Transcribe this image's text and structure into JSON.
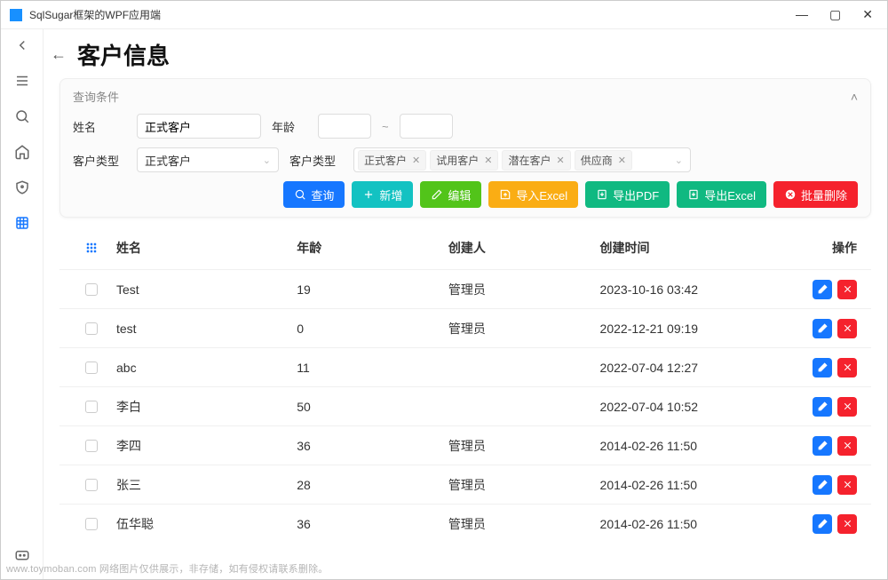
{
  "window": {
    "title": "SqlSugar框架的WPF应用端"
  },
  "page": {
    "title": "客户信息"
  },
  "filter": {
    "panel_label": "查询条件",
    "name_label": "姓名",
    "name_value": "正式客户",
    "age_label": "年龄",
    "type_label": "客户类型",
    "type_selected": "正式客户",
    "type2_label": "客户类型",
    "tags": [
      "正式客户",
      "试用客户",
      "潜在客户",
      "供应商"
    ]
  },
  "buttons": {
    "query": "查询",
    "add": "新增",
    "edit": "编辑",
    "import": "导入Excel",
    "export_pdf": "导出PDF",
    "export_excel": "导出Excel",
    "bulk_delete": "批量删除"
  },
  "columns": {
    "name": "姓名",
    "age": "年龄",
    "creator": "创建人",
    "time": "创建时间",
    "ops": "操作"
  },
  "rows": [
    {
      "name": "Test",
      "age": "19",
      "creator": "管理员",
      "time": "2023-10-16 03:42"
    },
    {
      "name": "test",
      "age": "0",
      "creator": "管理员",
      "time": "2022-12-21 09:19"
    },
    {
      "name": "abc",
      "age": "11",
      "creator": "",
      "time": "2022-07-04 12:27"
    },
    {
      "name": "李白",
      "age": "50",
      "creator": "",
      "time": "2022-07-04 10:52"
    },
    {
      "name": "李四",
      "age": "36",
      "creator": "管理员",
      "time": "2014-02-26 11:50"
    },
    {
      "name": "张三",
      "age": "28",
      "creator": "管理员",
      "time": "2014-02-26 11:50"
    },
    {
      "name": "伍华聪",
      "age": "36",
      "creator": "管理员",
      "time": "2014-02-26 11:50"
    }
  ],
  "watermark": "www.toymoban.com 网络图片仅供展示，非存储，如有侵权请联系删除。"
}
